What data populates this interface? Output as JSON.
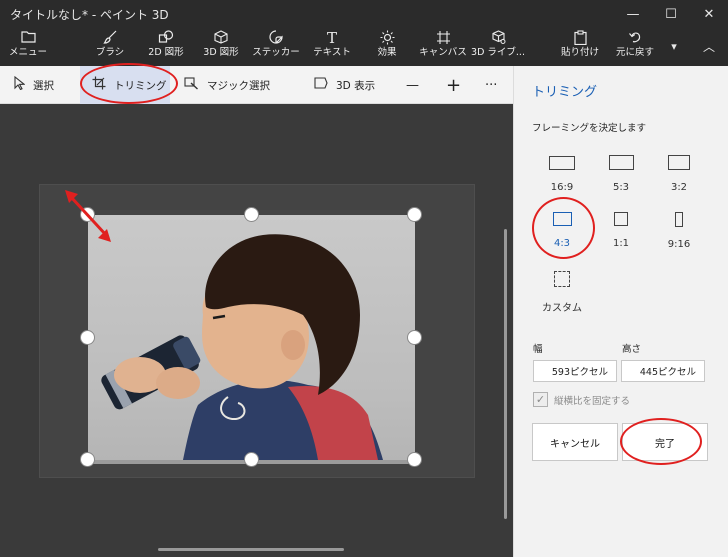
{
  "window": {
    "title": "タイトルなし* - ペイント 3D",
    "minimize_glyph": "—",
    "maximize_glyph": "☐",
    "close_glyph": "✕"
  },
  "ribbon": {
    "items": [
      {
        "label": "メニュー",
        "icon": "folder-icon"
      },
      {
        "label": "ブラシ",
        "icon": "brush-icon"
      },
      {
        "label": "2D 図形",
        "icon": "2d-shapes-icon"
      },
      {
        "label": "3D 図形",
        "icon": "3d-shapes-icon"
      },
      {
        "label": "ステッカー",
        "icon": "sticker-icon"
      },
      {
        "label": "テキスト",
        "icon": "text-icon"
      },
      {
        "label": "効果",
        "icon": "effects-icon"
      },
      {
        "label": "キャンバス",
        "icon": "canvas-icon"
      },
      {
        "label": "3D ライブ...",
        "icon": "3d-library-icon"
      },
      {
        "label": "貼り付け",
        "icon": "paste-icon"
      },
      {
        "label": "元に戻す",
        "icon": "undo-icon"
      }
    ],
    "text_icon_glyph": "T",
    "dropdown_glyph": "▾",
    "collapse_glyph": "︿"
  },
  "toolbar": {
    "select_label": "選択",
    "crop_label": "トリミング",
    "magic_select_label": "マジック選択",
    "view3d_label": "3D 表示",
    "zoom_out_glyph": "—",
    "zoom_in_glyph": "+",
    "more_glyph": "···"
  },
  "panel": {
    "title": "トリミング",
    "subtitle": "フレーミングを決定します",
    "ratios": [
      {
        "label": "16:9",
        "selected": false
      },
      {
        "label": "5:3",
        "selected": false
      },
      {
        "label": "3:2",
        "selected": false
      },
      {
        "label": "4:3",
        "selected": true
      },
      {
        "label": "1:1",
        "selected": false
      },
      {
        "label": "9:16",
        "selected": false
      },
      {
        "label": "カスタム",
        "selected": false
      }
    ],
    "width_label": "幅",
    "height_label": "高さ",
    "width_value": "593ピクセル",
    "height_value": "445ピクセル",
    "lock_label": "縦横比を固定する",
    "lock_checked": true,
    "cancel_label": "キャンセル",
    "done_label": "完了"
  },
  "colors": {
    "accent": "#1a5fb4",
    "annotation": "#e0201f",
    "canvas": "#3a3a3a",
    "titlebar": "#2b2b2b"
  }
}
